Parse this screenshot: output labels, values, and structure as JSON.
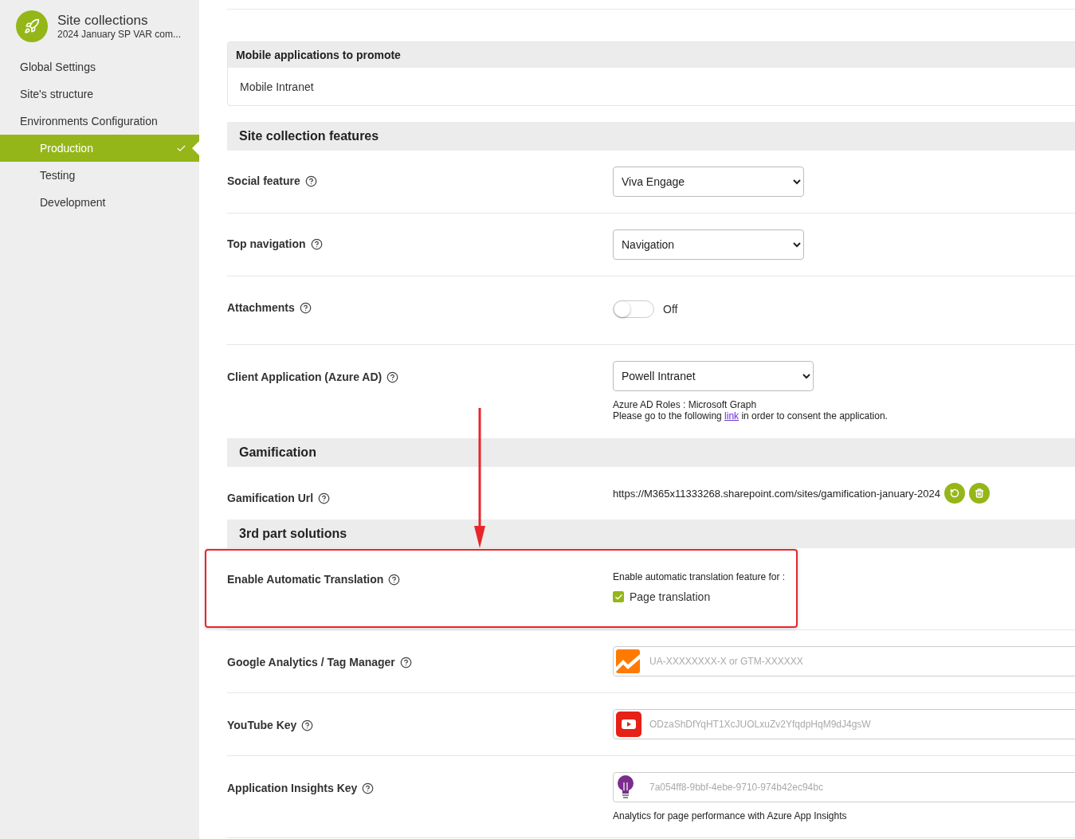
{
  "sidebar": {
    "title": "Site collections",
    "subtitle": "2024 January SP VAR com...",
    "items": [
      {
        "label": "Global Settings",
        "selected": false
      },
      {
        "label": "Site's structure",
        "selected": false
      },
      {
        "label": "Environments Configuration",
        "selected": false,
        "children": [
          {
            "label": "Production",
            "selected": true
          },
          {
            "label": "Testing",
            "selected": false
          },
          {
            "label": "Development",
            "selected": false
          }
        ]
      }
    ]
  },
  "mobile_apps": {
    "heading": "Mobile applications to promote",
    "items": [
      "Mobile Intranet"
    ]
  },
  "sections": [
    {
      "heading": "Site collection features",
      "rows": [
        {
          "kind": "select",
          "label": "Social feature",
          "value": "Viva Engage"
        },
        {
          "kind": "select",
          "label": "Top navigation",
          "value": "Navigation"
        },
        {
          "kind": "toggle",
          "label": "Attachments",
          "on": false,
          "state_text": "Off"
        },
        {
          "kind": "select",
          "label": "Client Application (Azure AD)",
          "value": "Powell Intranet",
          "note": "Azure AD Roles : Microsoft Graph",
          "consent": {
            "before": "Please go to the following ",
            "link": "link",
            "after": " in order to consent the application."
          }
        }
      ]
    },
    {
      "heading": "Gamification",
      "rows": [
        {
          "kind": "url",
          "label": "Gamification Url",
          "value": "https://M365x11333268.sharepoint.com/sites/gamification-january-2024"
        }
      ]
    },
    {
      "heading": "3rd part solutions",
      "rows": [
        {
          "kind": "checkboxes",
          "label": "Enable Automatic Translation",
          "highlighted": true,
          "caption": "Enable automatic translation feature for :",
          "options": [
            {
              "label": "Page translation",
              "checked": true
            }
          ]
        },
        {
          "kind": "chart-field",
          "label": "Google Analytics / Tag Manager",
          "placeholder": "UA-XXXXXXXX-X or GTM-XXXXXX"
        },
        {
          "kind": "video-field",
          "label": "YouTube Key",
          "placeholder": "ODzaShDfYqHT1XcJUOLxuZv2YfqdpHqM9dJ4gsW"
        },
        {
          "kind": "bulb-field",
          "label": "Application Insights Key",
          "placeholder": "7a054ff8-9bbf-4ebe-9710-974b42ec94bc",
          "note": "Analytics for page performance with Azure App Insights"
        }
      ]
    }
  ]
}
